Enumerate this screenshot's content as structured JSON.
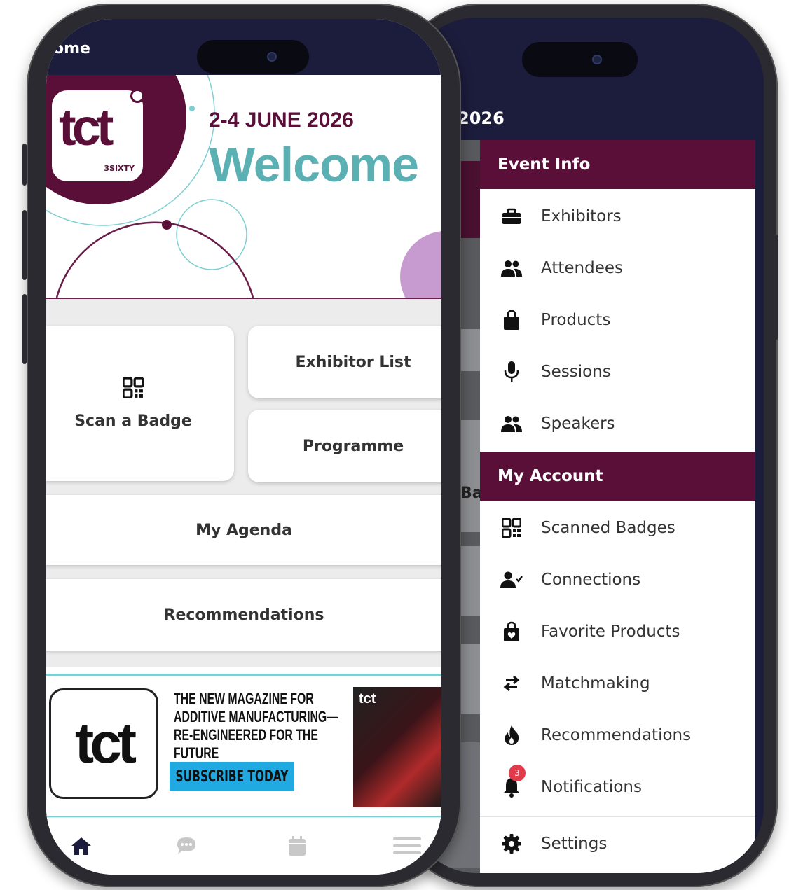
{
  "back_phone": {
    "title": "2026",
    "dim_label": "Ba",
    "drawer": {
      "sections": [
        {
          "header": "Event Info",
          "items": [
            {
              "label": "Exhibitors",
              "icon": "briefcase-icon"
            },
            {
              "label": "Attendees",
              "icon": "people-icon"
            },
            {
              "label": "Products",
              "icon": "shopping-bag-icon"
            },
            {
              "label": "Sessions",
              "icon": "microphone-icon"
            },
            {
              "label": "Speakers",
              "icon": "people-icon"
            }
          ]
        },
        {
          "header": "My Account",
          "items": [
            {
              "label": "Scanned Badges",
              "icon": "qr-code-icon"
            },
            {
              "label": "Connections",
              "icon": "user-check-icon"
            },
            {
              "label": "Favorite Products",
              "icon": "favorite-bag-icon"
            },
            {
              "label": "Matchmaking",
              "icon": "swap-arrows-icon"
            },
            {
              "label": "Recommendations",
              "icon": "flame-icon"
            },
            {
              "label": "Notifications",
              "icon": "bell-icon",
              "badge": "3"
            },
            {
              "label": "Settings",
              "icon": "gear-icon"
            }
          ]
        }
      ]
    }
  },
  "front_phone": {
    "status_text": "ome",
    "hero": {
      "logo_text": "tct",
      "logo_sub": "3SIXTY",
      "date": "2-4 JUNE 2026",
      "welcome": "Welcome"
    },
    "tiles": {
      "scan_badge": "Scan a Badge",
      "exhibitor_list": "Exhibitor List",
      "programme": "Programme",
      "my_agenda": "My Agenda",
      "recommendations": "Recommendations"
    },
    "banner": {
      "logo_text": "tct",
      "headline_1": "THE NEW MAGAZINE FOR",
      "headline_2": "ADDITIVE MANUFACTURING—",
      "headline_3": "RE-ENGINEERED FOR THE FUTURE",
      "button": "SUBSCRIBE TODAY",
      "cover_masthead": "tct"
    },
    "tabbar": [
      "home-icon",
      "chat-icon",
      "calendar-icon",
      "menu-icon"
    ]
  },
  "colors": {
    "brand_plum": "#5a0f38",
    "teal": "#5bb0b4",
    "navy_status": "#1c1c3c",
    "subscribe_blue": "#21a9e1",
    "notification_red": "#e23b4b"
  }
}
